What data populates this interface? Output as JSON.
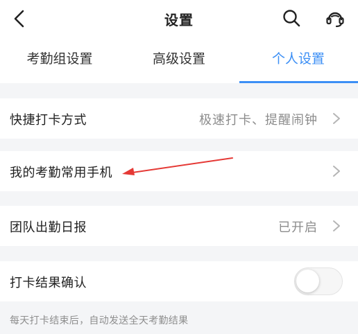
{
  "header": {
    "title": "设置",
    "back_icon": "chevron-left-icon",
    "search_icon": "search-icon",
    "service_icon": "customer-service-icon"
  },
  "tabs": [
    {
      "label": "考勤组设置",
      "active": false
    },
    {
      "label": "高级设置",
      "active": false
    },
    {
      "label": "个人设置",
      "active": true
    }
  ],
  "settings": {
    "quick_punch": {
      "label": "快捷打卡方式",
      "value": "极速打卡、提醒闹钟"
    },
    "common_phone": {
      "label": "我的考勤常用手机",
      "value": ""
    },
    "team_report": {
      "label": "团队出勤日报",
      "value": "已开启"
    },
    "punch_confirm": {
      "label": "打卡结果确认",
      "enabled": false,
      "hint": "每天打卡结束后，自动发送全天考勤结果"
    }
  },
  "colors": {
    "accent": "#3c8ff5",
    "annotation_arrow": "#e53935",
    "background": "#f4f5f7"
  }
}
